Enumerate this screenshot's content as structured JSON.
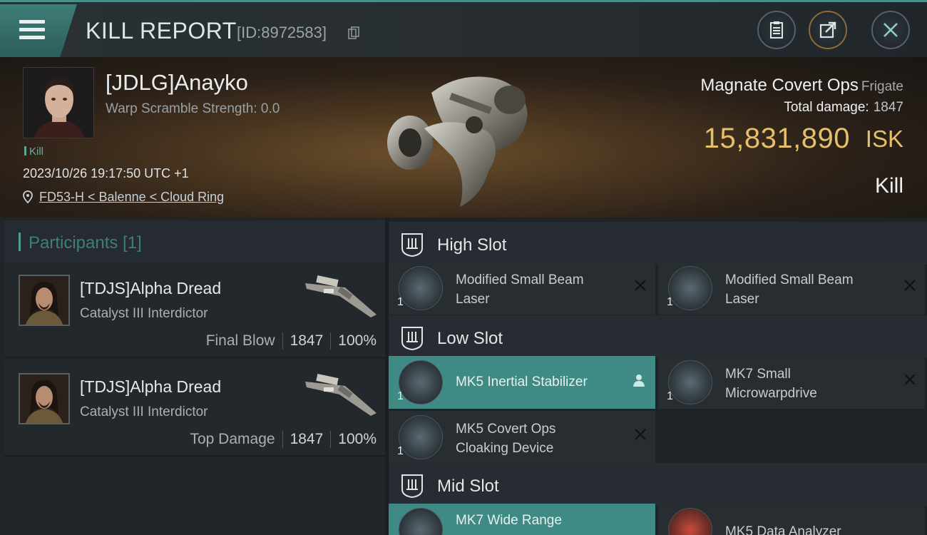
{
  "header": {
    "title": "KILL REPORT",
    "report_id": "[ID:8972583]",
    "icons": [
      "menu-icon",
      "copy-icon",
      "clipboard-icon",
      "share-icon",
      "close-icon"
    ]
  },
  "victim": {
    "name": "[JDLG]Anayko",
    "warp_scramble": "Warp Scramble Strength: 0.0",
    "tag": "Kill",
    "datetime": "2023/10/26 19:17:50 UTC +1",
    "location": "FD53-H < Balenne < Cloud Ring"
  },
  "ship": {
    "name": "Magnate Covert Ops",
    "class": "Frigate",
    "total_damage_label": "Total damage:",
    "total_damage": "1847",
    "isk_value": "15,831,890",
    "isk_unit": "ISK",
    "result": "Kill"
  },
  "participants": {
    "label": "Participants [1]",
    "rows": [
      {
        "name": "[TDJS]Alpha Dread",
        "ship": "Catalyst III Interdictor",
        "role": "Final Blow",
        "damage": "1847",
        "percent": "100%"
      },
      {
        "name": "[TDJS]Alpha Dread",
        "ship": "Catalyst III Interdictor",
        "role": "Top Damage",
        "damage": "1847",
        "percent": "100%"
      }
    ]
  },
  "slots": {
    "high": {
      "label": "High Slot",
      "items": [
        {
          "line1": "Modified Small Beam",
          "line2": "Laser",
          "qty": "1"
        },
        {
          "line1": "Modified Small Beam",
          "line2": "Laser",
          "qty": "1"
        }
      ]
    },
    "low": {
      "label": "Low Slot",
      "items": [
        {
          "line1": "MK5 Inertial Stabilizer",
          "line2": "",
          "qty": "1"
        },
        {
          "line1": "MK7 Small",
          "line2": "Microwarpdrive",
          "qty": "1"
        },
        {
          "line1": "MK5 Covert Ops",
          "line2": "Cloaking Device",
          "qty": "1"
        }
      ]
    },
    "mid": {
      "label": "Mid Slot",
      "items": [
        {
          "line1": "MK7 Wide Range",
          "line2": "",
          "qty": ""
        },
        {
          "line1": "MK5 Data Analyzer",
          "line2": "",
          "qty": ""
        }
      ]
    }
  },
  "colors": {
    "accent": "#3f8a85",
    "isk": "#e5c06a"
  }
}
